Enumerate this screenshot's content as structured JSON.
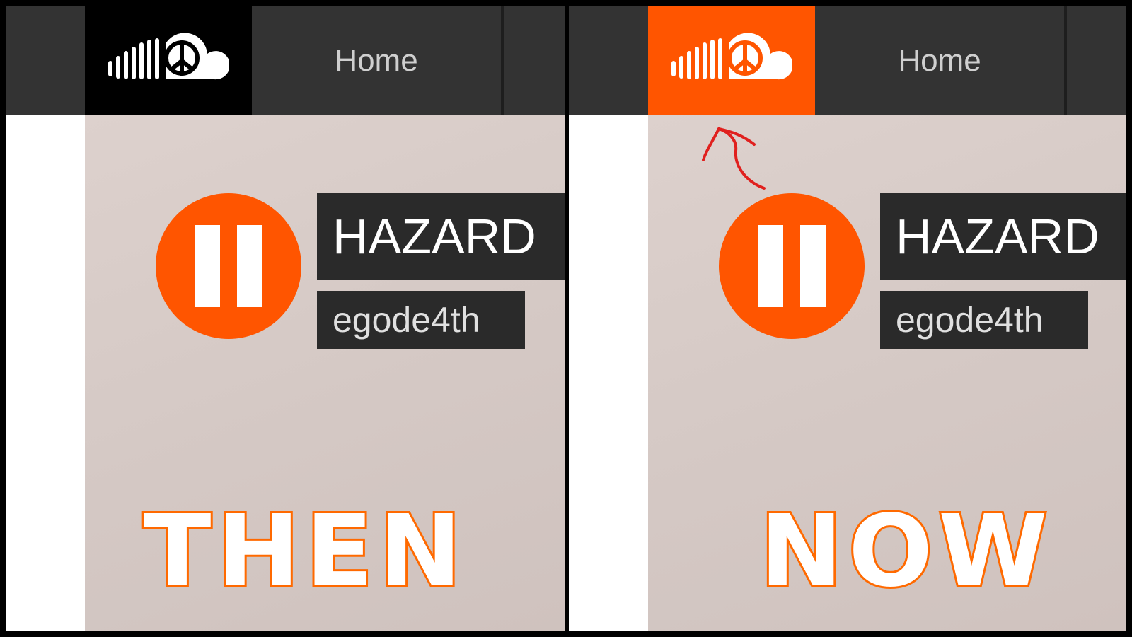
{
  "colors": {
    "brand": "#ff5500",
    "navbar": "#333333",
    "logo_tab_then": "#000000",
    "logo_tab_now": "#ff5500",
    "annotation": "#e0201e"
  },
  "icons": {
    "logo": "soundcloud-peace-cloud-icon",
    "pause": "pause-icon",
    "arrow": "hand-drawn-arrow-icon"
  },
  "panels": [
    {
      "nav": {
        "home_label": "Home"
      },
      "player": {
        "track_title": "HAZARD",
        "artist": "egode4th"
      },
      "caption": "THEN"
    },
    {
      "nav": {
        "home_label": "Home"
      },
      "player": {
        "track_title": "HAZARD",
        "artist": "egode4th"
      },
      "caption": "NOW"
    }
  ]
}
